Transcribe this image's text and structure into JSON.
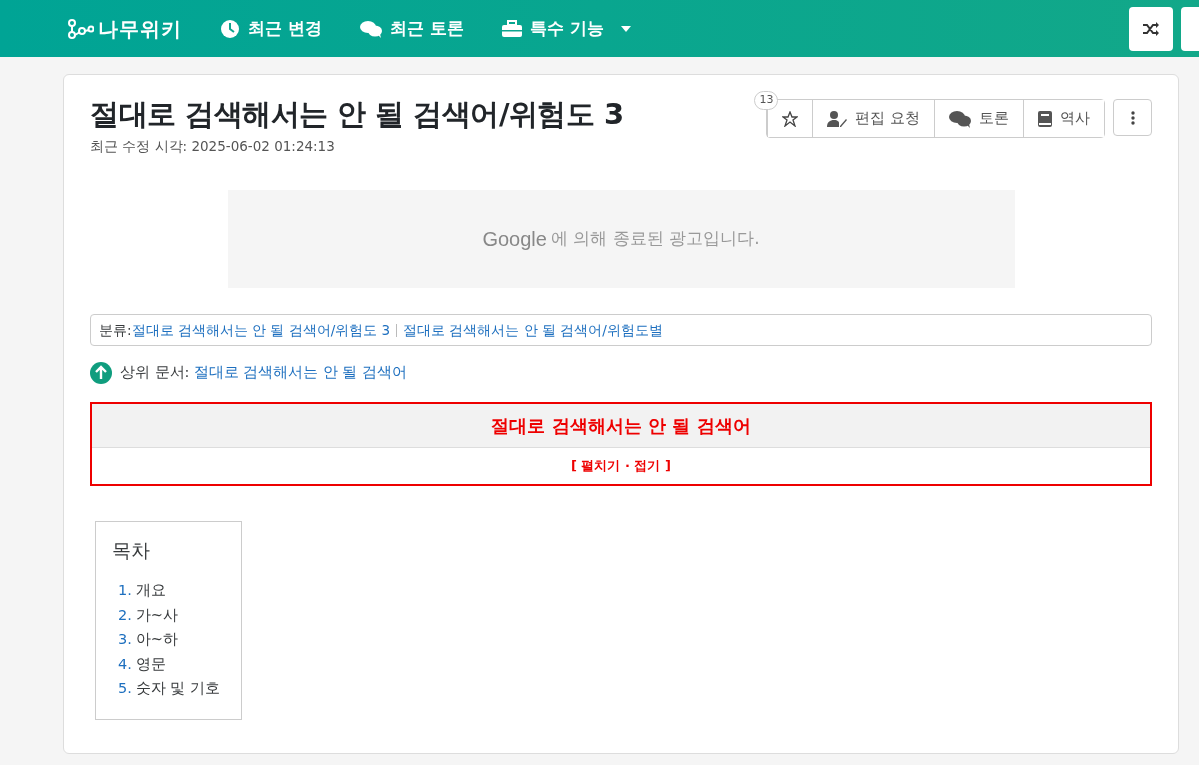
{
  "navbar": {
    "logo": "나무위키",
    "items": [
      {
        "label": "최근 변경",
        "kind": "clock"
      },
      {
        "label": "최근 토론",
        "kind": "chat"
      },
      {
        "label": "특수 기능",
        "kind": "toolbox",
        "dropdown": true
      }
    ]
  },
  "article": {
    "title": "절대로 검색해서는 안 될 검색어/위험도 3",
    "star_count": "13",
    "actions": [
      {
        "label": "편집 요청",
        "kind": "user-edit"
      },
      {
        "label": "토론",
        "kind": "chat"
      },
      {
        "label": "역사",
        "kind": "book"
      }
    ],
    "modified": "최근 수정 시각: 2025-06-02 01:24:13"
  },
  "ad": {
    "brand": "Google",
    "text": "에 의해 종료된 광고입니다."
  },
  "categories": {
    "label": "분류:",
    "links": [
      "절대로 검색해서는 안 될 검색어/위험도 3",
      "절대로 검색해서는 안 될 검색어/위험도별"
    ]
  },
  "parent": {
    "label": "상위 문서:",
    "link": "절대로 검색해서는 안 될 검색어"
  },
  "navbox": {
    "title": "절대로 검색해서는 안 될 검색어",
    "toggle": "[ 펼치기 · 접기 ]"
  },
  "toc": {
    "title": "목차",
    "items": [
      {
        "number": "1.",
        "label": "개요"
      },
      {
        "number": "2.",
        "label": "가~사"
      },
      {
        "number": "3.",
        "label": "아~하"
      },
      {
        "number": "4.",
        "label": "영문"
      },
      {
        "number": "5.",
        "label": "숫자 및 기호"
      }
    ]
  }
}
